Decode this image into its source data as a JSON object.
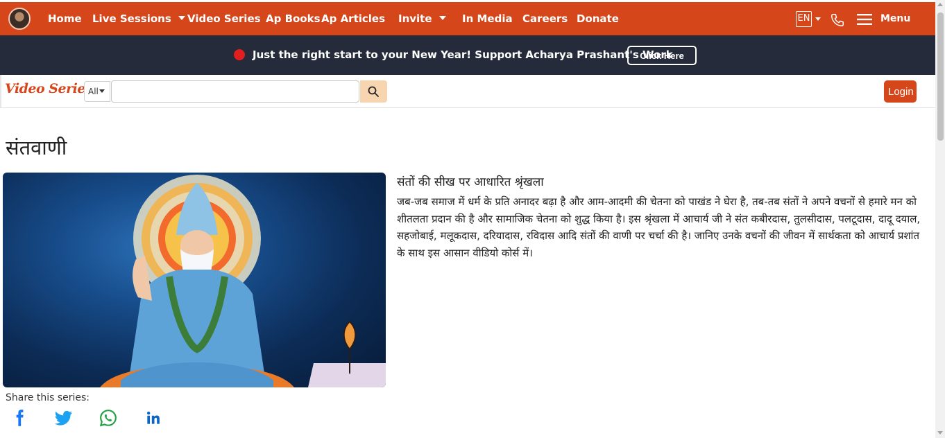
{
  "nav": {
    "items": [
      {
        "label": "Home"
      },
      {
        "label": "Live Sessions"
      },
      {
        "label": "Video Series"
      },
      {
        "label": "Ap Books"
      },
      {
        "label": "Ap Articles"
      },
      {
        "label": "Invite"
      },
      {
        "label": "In Media"
      },
      {
        "label": "Careers"
      },
      {
        "label": "Donate"
      }
    ],
    "lang": "EN",
    "menu_label": "Menu",
    "accent": "#d5461b"
  },
  "announce": {
    "text": "Just the right start to your New Year! Support Acharya Prashant's Work",
    "button": "Click Here",
    "bg": "#252b3a"
  },
  "search": {
    "brand": "Video Series",
    "filter_selected": "All",
    "value": "",
    "login": "Login"
  },
  "series": {
    "title": "संतवाणी",
    "subtitle": "संतों की सीख पर आधारित श्रृंखला",
    "description": "जब-जब समाज में धर्म के प्रति अनादर बढ़ा है और आम-आदमी की चेतना को पाखंड ने घेरा है, तब-तब संतों ने अपने वचनों से हमारे मन को शीतलता प्रदान की है और सामाजिक चेतना को शुद्ध किया है। इस श्रृंखला में आचार्य जी ने संत कबीरदास, तुलसीदास, पलटूदास, दादू दयाल, सहजोबाई, मलूकदास, दरियादास, रविदास आदि संतों की वाणी पर चर्चा की है। जानिए उनके वचनों की जीवन में सार्थकता को आचार्य प्रशांत के साथ इस आसान वीडियो कोर्स में।",
    "share_label": "Share this series:",
    "share_icons": [
      "facebook-icon",
      "twitter-icon",
      "whatsapp-icon",
      "linkedin-icon"
    ]
  }
}
